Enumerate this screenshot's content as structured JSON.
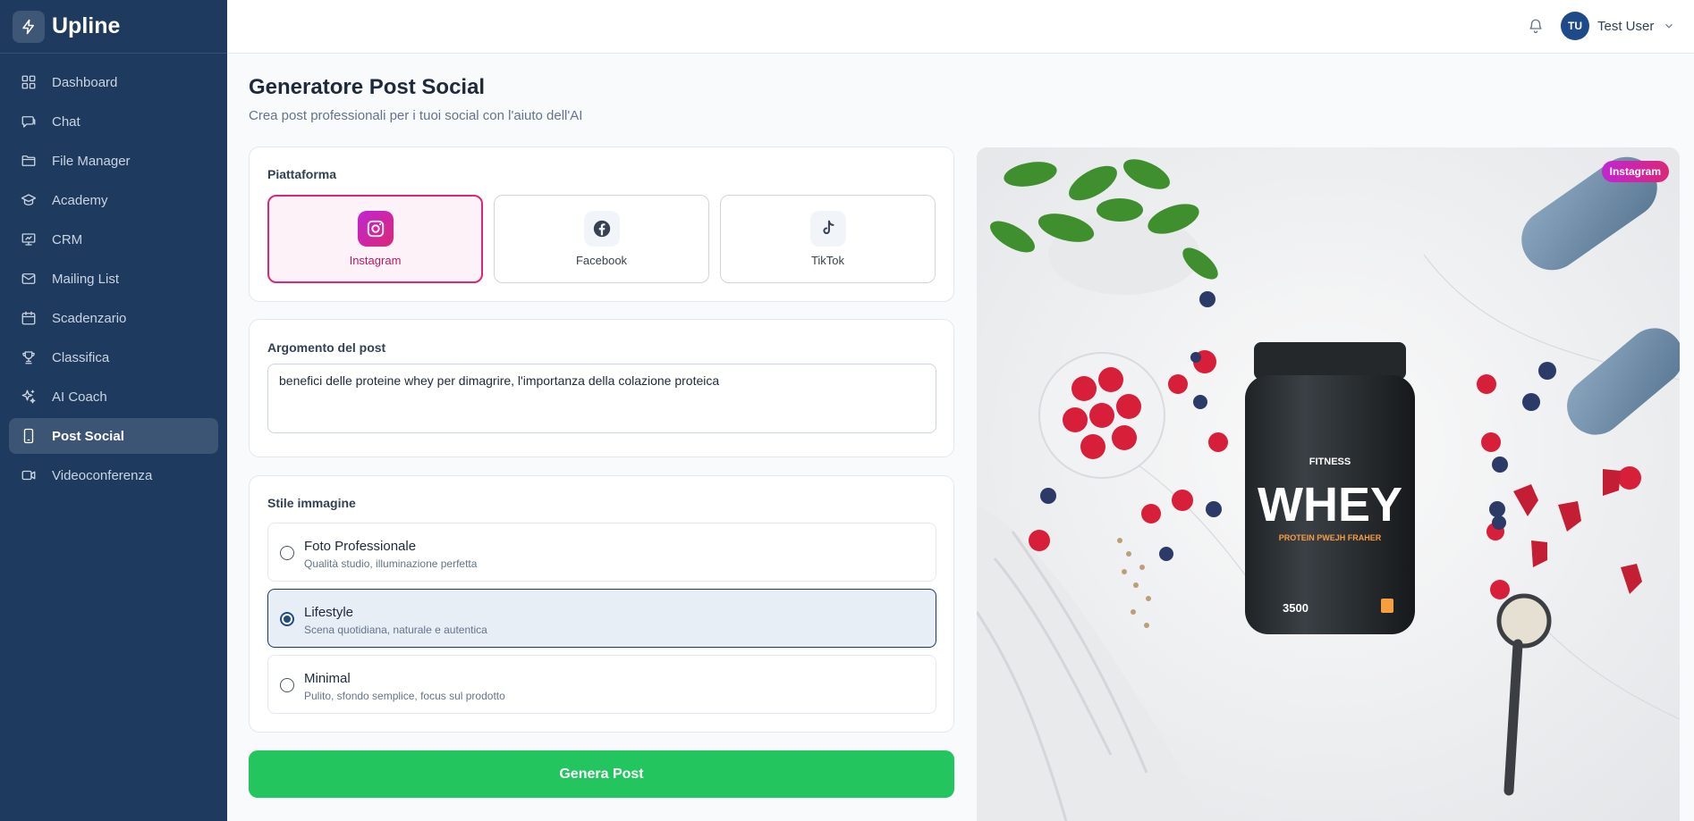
{
  "app": {
    "name": "Upline"
  },
  "sidebar": {
    "items": [
      {
        "label": "Dashboard",
        "icon": "grid-icon",
        "active": false
      },
      {
        "label": "Chat",
        "icon": "chat-icon",
        "active": false
      },
      {
        "label": "File Manager",
        "icon": "folder-icon",
        "active": false
      },
      {
        "label": "Academy",
        "icon": "graduation-cap-icon",
        "active": false
      },
      {
        "label": "CRM",
        "icon": "presentation-icon",
        "active": false
      },
      {
        "label": "Mailing List",
        "icon": "mail-icon",
        "active": false
      },
      {
        "label": "Scadenzario",
        "icon": "calendar-icon",
        "active": false
      },
      {
        "label": "Classifica",
        "icon": "trophy-icon",
        "active": false
      },
      {
        "label": "AI Coach",
        "icon": "sparkles-icon",
        "active": false
      },
      {
        "label": "Post Social",
        "icon": "smartphone-icon",
        "active": true
      },
      {
        "label": "Videoconferenza",
        "icon": "video-icon",
        "active": false
      }
    ]
  },
  "header": {
    "user": {
      "initials": "TU",
      "name": "Test User"
    }
  },
  "main": {
    "title": "Generatore Post Social",
    "subtitle": "Crea post professionali per i tuoi social con l'aiuto dell'AI",
    "platform": {
      "label": "Piattaforma",
      "options": [
        {
          "label": "Instagram",
          "icon": "instagram-icon",
          "selected": true
        },
        {
          "label": "Facebook",
          "icon": "facebook-icon",
          "selected": false
        },
        {
          "label": "TikTok",
          "icon": "tiktok-icon",
          "selected": false
        }
      ]
    },
    "topic": {
      "label": "Argomento del post",
      "value": "benefici delle proteine whey per dimagrire, l'importanza della colazione proteica"
    },
    "image_style": {
      "label": "Stile immagine",
      "options": [
        {
          "title": "Foto Professionale",
          "description": "Qualità studio, illuminazione perfetta",
          "selected": false
        },
        {
          "title": "Lifestyle",
          "description": "Scena quotidiana, naturale e autentica",
          "selected": true
        },
        {
          "title": "Minimal",
          "description": "Pulito, sfondo semplice, focus sul prodotto",
          "selected": false
        }
      ]
    },
    "generate_label": "Genera Post"
  },
  "preview": {
    "badge": "Instagram",
    "product": {
      "brand": "FITNESS",
      "name": "WHEY",
      "tagline": "PROTEIN PWEJH FRAHER",
      "amount": "3500"
    }
  },
  "colors": {
    "sidebar_bg": "#1e3a5f",
    "accent_pink": "#db2777",
    "generate_green": "#22c55e",
    "selected_blue": "#1e4a8a"
  }
}
